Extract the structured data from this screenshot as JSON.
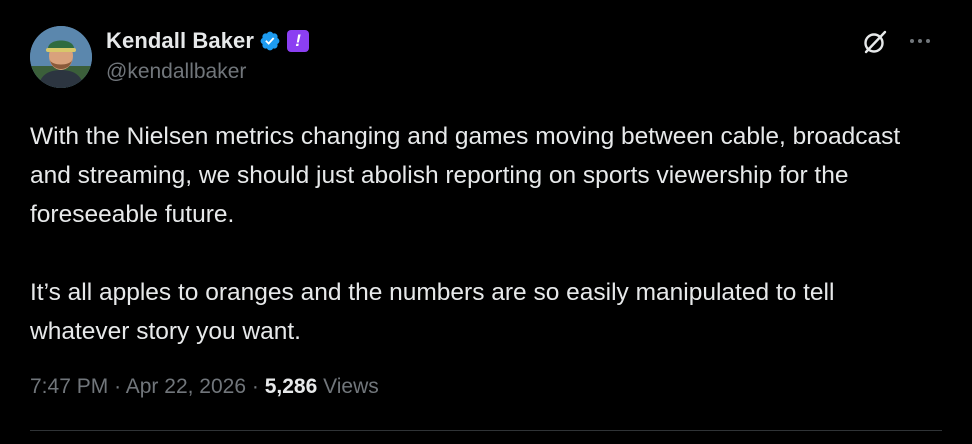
{
  "author": {
    "display_name": "Kendall Baker",
    "handle": "@kendallbaker"
  },
  "post": {
    "paragraphs": [
      "With the Nielsen metrics changing and games moving between cable, broadcast and streaming, we should just abolish reporting on sports viewership for the foreseeable future.",
      "It’s all apples to oranges and the numbers are so easily manipulated to tell whatever story you want."
    ],
    "time": "7:47 PM",
    "date": "Apr 22, 2026",
    "separator": "·",
    "views_count": "5,286",
    "views_label": "Views"
  },
  "icons": {
    "avatar": "avatar-photo",
    "verified": "verified-badge-icon",
    "affiliate": "affiliate-badge-icon",
    "grok": "grok-icon",
    "more": "more-icon"
  },
  "colors": {
    "background": "#000000",
    "primary_text": "#e7e9ea",
    "secondary_text": "#71767b",
    "verified_blue": "#1d9bf0",
    "affiliate_purple": "#8b3ff2"
  }
}
